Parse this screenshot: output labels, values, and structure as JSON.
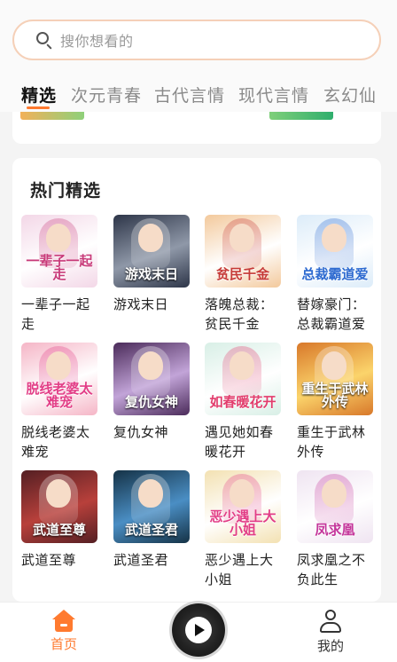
{
  "search": {
    "placeholder": "搜你想看的"
  },
  "tabs": [
    {
      "label": "精选",
      "active": true
    },
    {
      "label": "次元青春",
      "active": false
    },
    {
      "label": "古代言情",
      "active": false
    },
    {
      "label": "现代言情",
      "active": false
    },
    {
      "label": "玄幻仙",
      "active": false
    }
  ],
  "hot": {
    "title": "热门精选",
    "books": [
      {
        "title": "一辈子一起走",
        "cover_text": "一辈子一起走",
        "cover_colors": [
          "#f3d7e7",
          "#ffffff",
          "#c83a79"
        ]
      },
      {
        "title": "游戏末日",
        "cover_text": "游戏末日",
        "cover_colors": [
          "#2d3548",
          "#8f98a8",
          "#ffffff"
        ]
      },
      {
        "title": "落魄总裁：贫民千金",
        "cover_text": "贫民千金",
        "cover_colors": [
          "#f3c99c",
          "#ffffff",
          "#c63a37"
        ]
      },
      {
        "title": "替嫁豪门：总裁霸道爱",
        "cover_text": "总裁霸道爱",
        "cover_colors": [
          "#dcecf9",
          "#ffffff",
          "#2d6ad0"
        ]
      },
      {
        "title": "脱线老婆太难宠",
        "cover_text": "脱线老婆太难宠",
        "cover_colors": [
          "#f5b5c6",
          "#ffffff",
          "#e23d86"
        ]
      },
      {
        "title": "复仇女神",
        "cover_text": "复仇女神",
        "cover_colors": [
          "#4b2b5a",
          "#c2a4d8",
          "#ffffff"
        ]
      },
      {
        "title": "遇见她如春暖花开",
        "cover_text": "如春暖花开",
        "cover_colors": [
          "#d8efe6",
          "#ffffff",
          "#e23d6d"
        ]
      },
      {
        "title": "重生于武林外传",
        "cover_text": "重生于武林外传",
        "cover_colors": [
          "#d8782a",
          "#fbd46b",
          "#ffffff"
        ]
      },
      {
        "title": "武道至尊",
        "cover_text": "武道至尊",
        "cover_colors": [
          "#541f23",
          "#b8403b",
          "#ffffff"
        ]
      },
      {
        "title": "武道圣君",
        "cover_text": "武道圣君",
        "cover_colors": [
          "#153246",
          "#4a8ec4",
          "#ffffff"
        ]
      },
      {
        "title": "恶少遇上大小姐",
        "cover_text": "恶少遇上大小姐",
        "cover_colors": [
          "#f3e1b2",
          "#ffffff",
          "#e23d86"
        ]
      },
      {
        "title": "凤求凰之不负此生",
        "cover_text": "凤求凰",
        "cover_colors": [
          "#efe4f1",
          "#ffffff",
          "#c4359a"
        ]
      }
    ]
  },
  "nav": {
    "home": {
      "label": "首页",
      "color": "#ff7a2f"
    },
    "player_icon": "play-icon",
    "mine": {
      "label": "我的",
      "color": "#333333"
    }
  }
}
